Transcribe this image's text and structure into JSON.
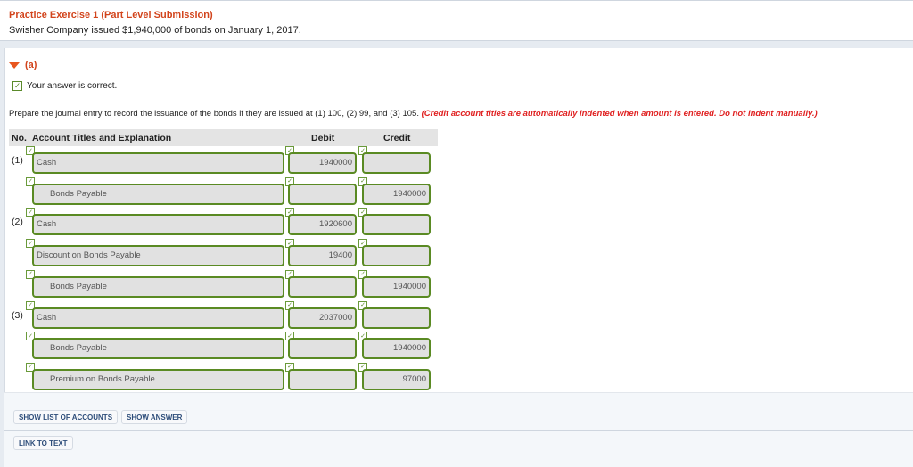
{
  "header": {
    "title": "Practice Exercise 1 (Part Level Submission)",
    "subtitle": "Swisher Company issued $1,940,000 of bonds on January 1, 2017."
  },
  "part": {
    "label": "(a)",
    "status": "Your answer is correct.",
    "instruction": "Prepare the journal entry to record the issuance of the bonds if they are issued at (1) 100, (2) 99, and (3) 105. ",
    "instruction_note": "(Credit account titles are automatically indented when amount is entered. Do not indent manually.)"
  },
  "table": {
    "headers": {
      "no": "No.",
      "account": "Account Titles and Explanation",
      "debit": "Debit",
      "credit": "Credit"
    },
    "rows": [
      {
        "no": "(1)",
        "account": "Cash",
        "debit": "1940000",
        "credit": "",
        "indent": false
      },
      {
        "no": "",
        "account": "Bonds Payable",
        "debit": "",
        "credit": "1940000",
        "indent": true
      },
      {
        "no": "(2)",
        "account": "Cash",
        "debit": "1920600",
        "credit": "",
        "indent": false
      },
      {
        "no": "",
        "account": "Discount on Bonds Payable",
        "debit": "19400",
        "credit": "",
        "indent": false
      },
      {
        "no": "",
        "account": "Bonds Payable",
        "debit": "",
        "credit": "1940000",
        "indent": true
      },
      {
        "no": "(3)",
        "account": "Cash",
        "debit": "2037000",
        "credit": "",
        "indent": false
      },
      {
        "no": "",
        "account": "Bonds Payable",
        "debit": "",
        "credit": "1940000",
        "indent": true
      },
      {
        "no": "",
        "account": "Premium on Bonds Payable",
        "debit": "",
        "credit": "97000",
        "indent": true
      }
    ]
  },
  "buttons": {
    "show_list": "SHOW LIST OF ACCOUNTS",
    "show_answer": "SHOW ANSWER",
    "link_to_text": "LINK TO TEXT"
  },
  "icons": {
    "check": "✓"
  },
  "colors": {
    "title": "#d2441c",
    "note": "#e02020",
    "field_border": "#5a8a23"
  }
}
